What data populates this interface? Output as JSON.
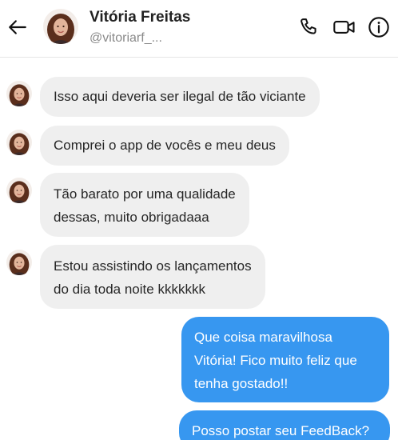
{
  "header": {
    "back_icon": "arrow-left-icon",
    "name": "Vitória Freitas",
    "handle": "@vitoriarf_...",
    "actions": [
      {
        "icon": "phone-icon"
      },
      {
        "icon": "video-camera-icon"
      },
      {
        "icon": "info-icon"
      }
    ]
  },
  "colors": {
    "incoming_bubble": "#efefef",
    "outgoing_bubble": "#3797f0",
    "incoming_text": "#262626",
    "outgoing_text": "#ffffff"
  },
  "messages": [
    {
      "direction": "incoming",
      "text": "Isso aqui deveria ser ilegal de tão viciante"
    },
    {
      "direction": "incoming",
      "text": "Comprei o app de vocês e meu deus"
    },
    {
      "direction": "incoming",
      "text": "Tão barato por uma qualidade\ndessas, muito obrigadaaa"
    },
    {
      "direction": "incoming",
      "text": "Estou assistindo os lançamentos\ndo dia toda noite kkkkkkk"
    },
    {
      "direction": "outgoing",
      "text": "Que coisa maravilhosa\nVitória! Fico muito feliz que\ntenha gostado!!"
    },
    {
      "direction": "outgoing",
      "text": "Posso postar seu FeedBack?"
    }
  ]
}
